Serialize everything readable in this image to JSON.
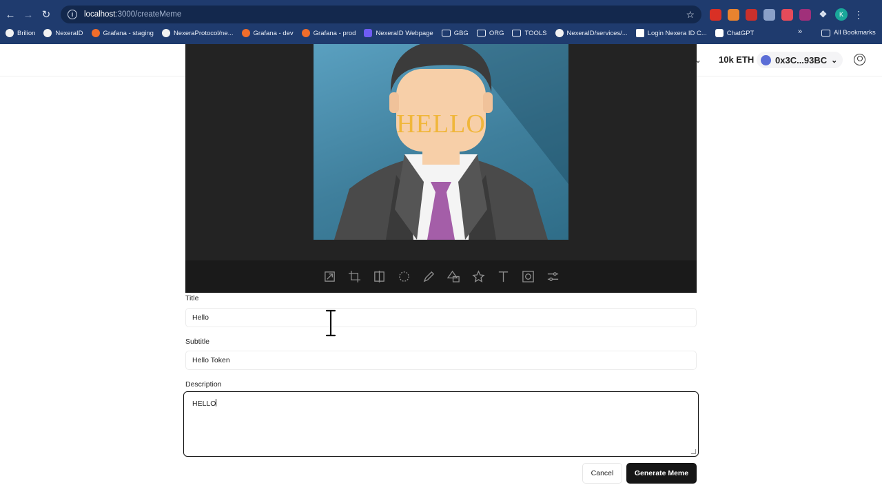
{
  "browser": {
    "url_host": "localhost",
    "url_path": ":3000/createMeme",
    "bookmarks": [
      {
        "label": "Brilion",
        "icon": "github-icon"
      },
      {
        "label": "NexeraID",
        "icon": "github-icon"
      },
      {
        "label": "Grafana - staging",
        "icon": "grafana-icon"
      },
      {
        "label": "NexeraProtocol/ne...",
        "icon": "github-icon"
      },
      {
        "label": "Grafana - dev",
        "icon": "grafana-icon"
      },
      {
        "label": "Grafana - prod",
        "icon": "grafana-icon"
      },
      {
        "label": "NexeraID Webpage",
        "icon": "nexera-icon"
      },
      {
        "label": "GBG",
        "icon": "folder-icon"
      },
      {
        "label": "ORG",
        "icon": "folder-icon"
      },
      {
        "label": "TOOLS",
        "icon": "folder-icon"
      },
      {
        "label": "NexeraID/services/...",
        "icon": "github-icon"
      },
      {
        "label": "Login Nexera ID C...",
        "icon": "id-icon"
      },
      {
        "label": "ChatGPT",
        "icon": "chatgpt-icon"
      }
    ],
    "all_bookmarks": "All Bookmarks",
    "profile_initial": "K"
  },
  "header": {
    "balance": "10k ETH",
    "account": "0x3C...93BC"
  },
  "editor": {
    "meme_text": "HELLO",
    "tools": [
      "resize-icon",
      "crop-icon",
      "flip-icon",
      "rotate-icon",
      "draw-icon",
      "shape-icon",
      "star-icon",
      "text-icon",
      "mask-icon",
      "filter-icon"
    ]
  },
  "form": {
    "title_label": "Title",
    "title_value": "Hello",
    "subtitle_label": "Subtitle",
    "subtitle_value": "Hello Token",
    "description_label": "Description",
    "description_value": "HELLO",
    "cancel_label": "Cancel",
    "submit_label": "Generate Meme"
  }
}
